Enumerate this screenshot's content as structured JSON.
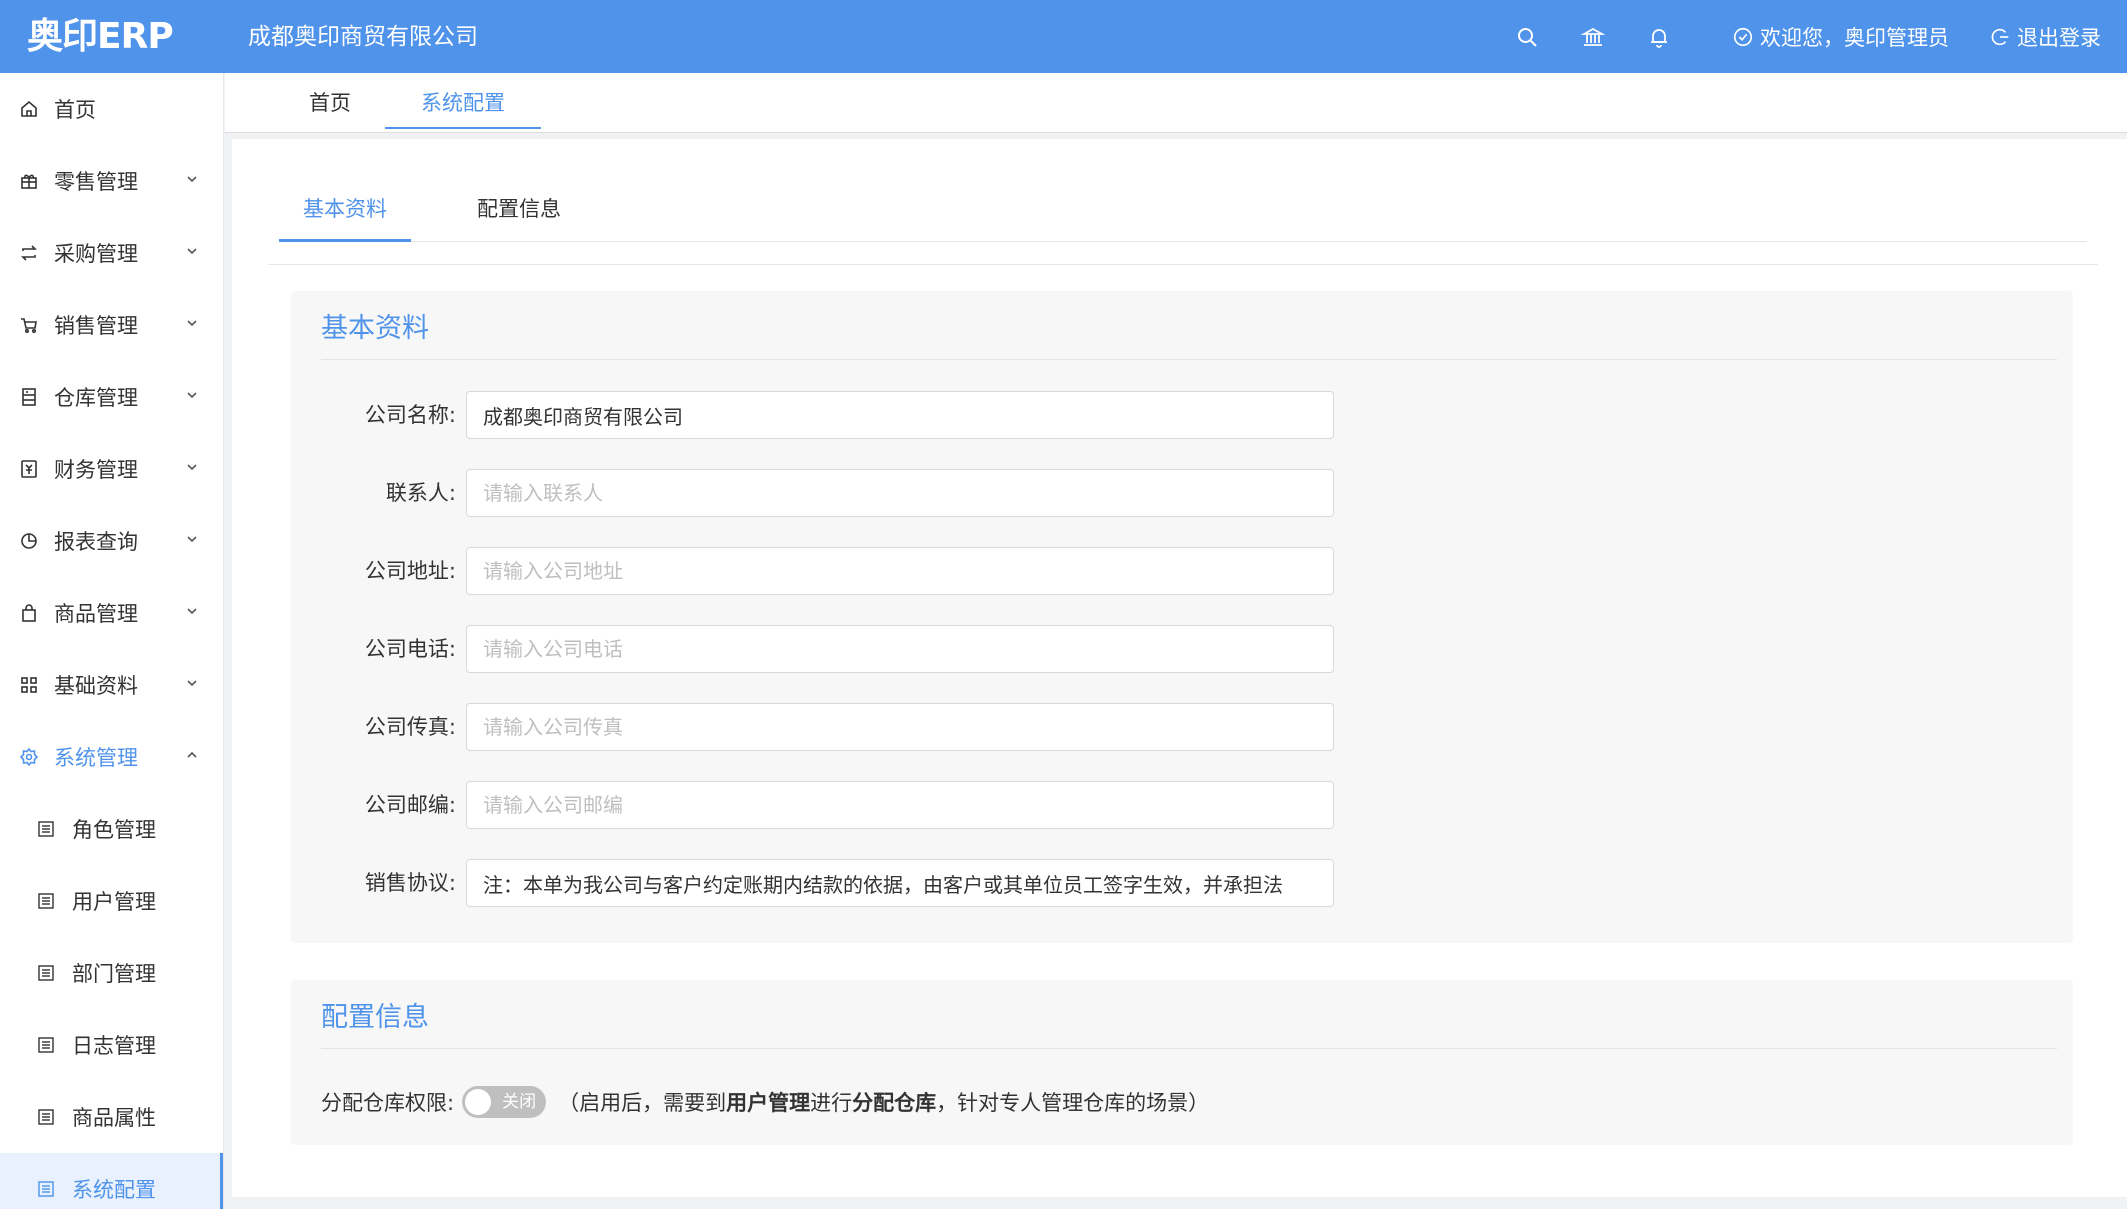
{
  "header": {
    "logo": "奥印ERP",
    "company": "成都奥印商贸有限公司",
    "icons": [
      "search-icon",
      "bank-icon",
      "bell-icon"
    ],
    "welcome": "欢迎您，奥印管理员",
    "logout": "退出登录",
    "bg_color": "#4f93ea"
  },
  "sidebar": {
    "items": [
      {
        "label": "首页",
        "icon": "home-icon",
        "expandable": false
      },
      {
        "label": "零售管理",
        "icon": "gift-icon",
        "expandable": true
      },
      {
        "label": "采购管理",
        "icon": "swap-icon",
        "expandable": true
      },
      {
        "label": "销售管理",
        "icon": "cart-icon",
        "expandable": true
      },
      {
        "label": "仓库管理",
        "icon": "storage-icon",
        "expandable": true
      },
      {
        "label": "财务管理",
        "icon": "money-icon",
        "expandable": true
      },
      {
        "label": "报表查询",
        "icon": "pie-chart-icon",
        "expandable": true
      },
      {
        "label": "商品管理",
        "icon": "bag-icon",
        "expandable": true
      },
      {
        "label": "基础资料",
        "icon": "grid-icon",
        "expandable": true
      },
      {
        "label": "系统管理",
        "icon": "gear-icon",
        "expandable": true,
        "expanded": true
      }
    ],
    "sub_items": [
      {
        "label": "角色管理",
        "icon": "list-icon"
      },
      {
        "label": "用户管理",
        "icon": "list-icon"
      },
      {
        "label": "部门管理",
        "icon": "list-icon"
      },
      {
        "label": "日志管理",
        "icon": "list-icon"
      },
      {
        "label": "商品属性",
        "icon": "list-icon"
      },
      {
        "label": "系统配置",
        "icon": "list-icon",
        "current": true
      }
    ]
  },
  "top_tabs": [
    {
      "label": "首页"
    },
    {
      "label": "系统配置",
      "active": true
    }
  ],
  "inner_tabs": [
    {
      "label": "基本资料",
      "active": true
    },
    {
      "label": "配置信息"
    }
  ],
  "basic_info": {
    "title": "基本资料",
    "fields": [
      {
        "label": "公司名称:",
        "value": "成都奥印商贸有限公司",
        "placeholder": ""
      },
      {
        "label": "联系人:",
        "value": "",
        "placeholder": "请输入联系人"
      },
      {
        "label": "公司地址:",
        "value": "",
        "placeholder": "请输入公司地址"
      },
      {
        "label": "公司电话:",
        "value": "",
        "placeholder": "请输入公司电话"
      },
      {
        "label": "公司传真:",
        "value": "",
        "placeholder": "请输入公司传真"
      },
      {
        "label": "公司邮编:",
        "value": "",
        "placeholder": "请输入公司邮编"
      },
      {
        "label": "销售协议:",
        "value": "注：本单为我公司与客户约定账期内结款的依据，由客户或其单位员工签字生效，并承担法",
        "placeholder": ""
      }
    ]
  },
  "config_info": {
    "title": "配置信息",
    "switch_label": "分配仓库权限:",
    "switch_state": "关闭",
    "hint_prefix": "（启用后，需要到",
    "hint_bold1": "用户管理",
    "hint_mid": "进行",
    "hint_bold2": "分配仓库",
    "hint_suffix": "，针对专人管理仓库的场景）"
  }
}
